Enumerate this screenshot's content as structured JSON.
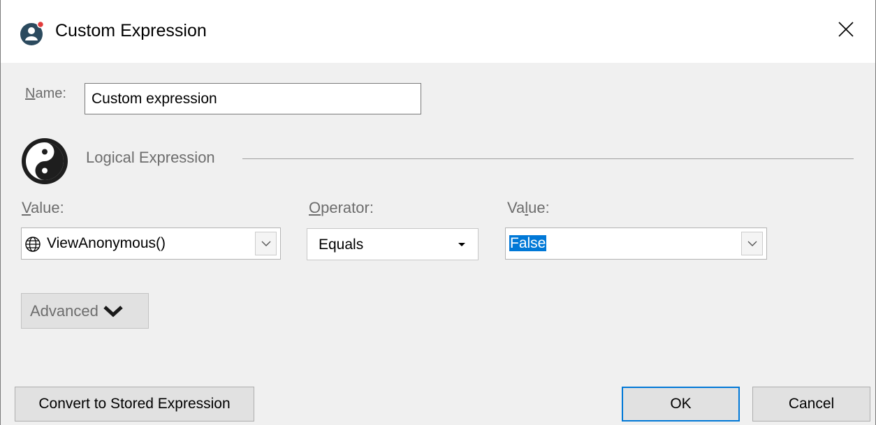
{
  "window": {
    "title": "Custom Expression",
    "app_icon": "user-badge-icon",
    "close_icon": "close-icon"
  },
  "name": {
    "label_accel": "N",
    "label_rest": "ame:",
    "value": "Custom expression"
  },
  "section": {
    "icon": "yin-yang-icon",
    "label": "Logical Expression"
  },
  "left_value": {
    "label_accel": "V",
    "label_rest": "alue:",
    "icon": "globe-icon",
    "selected": "ViewAnonymous()"
  },
  "operator": {
    "label_accel": "O",
    "label_rest": "perator:",
    "selected": "Equals"
  },
  "right_value": {
    "label_prefix": "Va",
    "label_accel": "l",
    "label_rest": "ue:",
    "selected": "False"
  },
  "advanced": {
    "label": "Advanced",
    "icon": "chevron-down-icon"
  },
  "buttons": {
    "convert": "Convert to Stored Expression",
    "ok": "OK",
    "cancel": "Cancel"
  },
  "colors": {
    "accent": "#0078d7",
    "dialog_bg": "#f0f0f0",
    "label_gray": "#6d6d6d"
  }
}
